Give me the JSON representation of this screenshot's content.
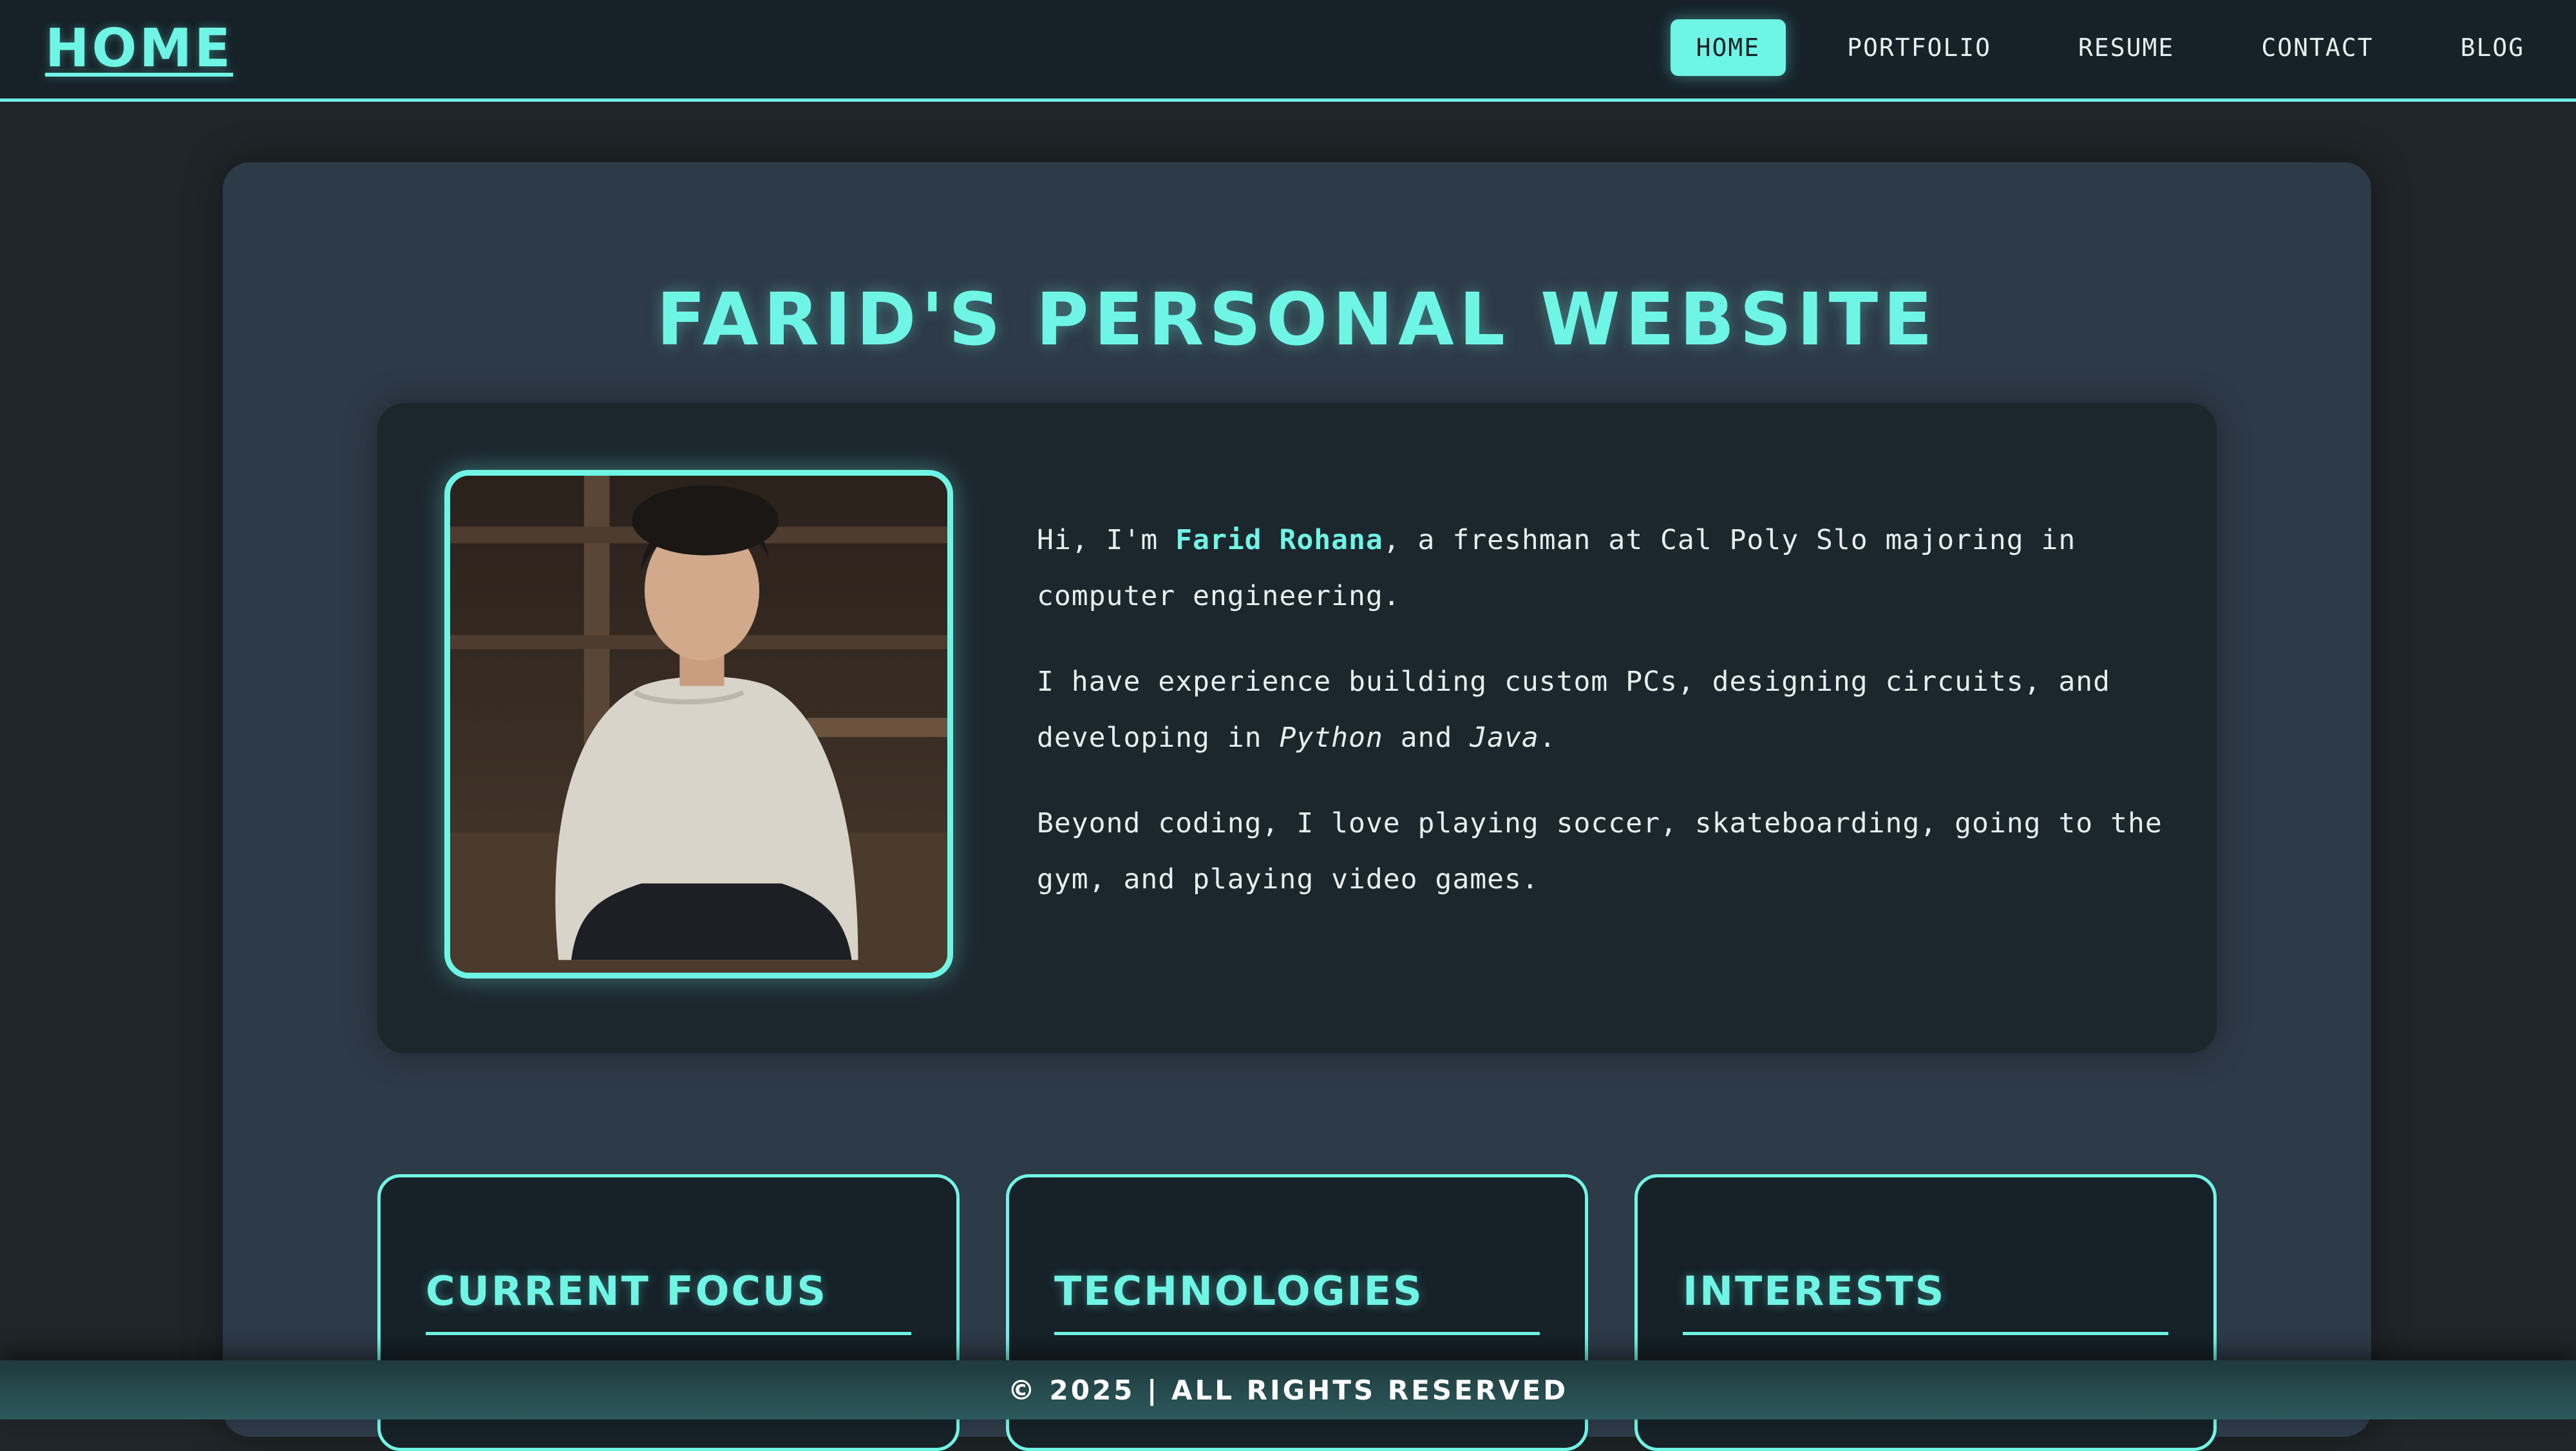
{
  "nav": {
    "brand": "HOME",
    "links": [
      "HOME",
      "PORTFOLIO",
      "RESUME",
      "CONTACT",
      "BLOG"
    ],
    "active": "HOME"
  },
  "main": {
    "title": "FARID'S PERSONAL WEBSITE",
    "photo_alt": "Portrait of Farid Rohana",
    "bio": {
      "p1_prefix": "Hi, I'm ",
      "p1_name": "Farid Rohana",
      "p1_suffix": ", a freshman at Cal Poly Slo majoring in computer engineering.",
      "p2_prefix": "I have experience building custom PCs, designing circuits, and developing in ",
      "p2_lang1": "Python",
      "p2_mid": " and ",
      "p2_lang2": "Java",
      "p2_suffix": ".",
      "p3": "Beyond coding, I love playing soccer, skateboarding, going to the gym, and playing video games."
    },
    "cards": [
      "CURRENT FOCUS",
      "TECHNOLOGIES",
      "INTERESTS"
    ]
  },
  "footer": {
    "text": "© 2025 | ALL RIGHTS RESERVED"
  },
  "colors": {
    "accent": "#6ff5e6",
    "background": "#1f2528",
    "panel": "#2d3a47",
    "card": "#1c262d"
  }
}
